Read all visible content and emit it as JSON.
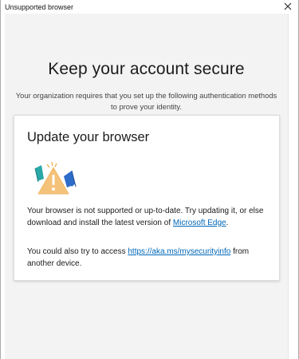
{
  "window": {
    "title": "Unsupported browser"
  },
  "page": {
    "heading": "Keep your account secure",
    "subtitle": "Your organization requires that you set up the following authentication methods to prove your identity."
  },
  "card": {
    "title": "Update your browser",
    "para1_text": "Your browser is not supported or up-to-date. Try updating it, or else download and install the latest version of",
    "para1_link": "Microsoft Edge",
    "para1_end": ".",
    "para2_text": "You could also try to access",
    "para2_link": "https://aka.ms/mysecurityinfo",
    "para2_end": " from another device."
  },
  "colors": {
    "link": "#0067b8",
    "warning_triangle": "#f5c27a",
    "accent_teal": "#2aa7a8",
    "accent_blue": "#2d6cc9"
  },
  "icons": {
    "close": "close-icon",
    "illustration": "warning-browser-icon"
  }
}
